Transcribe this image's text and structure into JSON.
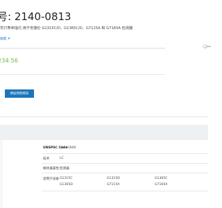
{
  "product": {
    "title_prefix": "号:",
    "part_number": "2140-0813",
    "description": "氘灯寿命指灯,用于安捷伦 G1315C/D、G1365C/D、G7115A 和 G7165A 检测器",
    "collapse_label": "收起",
    "price": "234.56",
    "add_to_cart_label": "添加到购物车"
  },
  "specs": {
    "rows": [
      {
        "label": "UNSPSC Code",
        "value": "39101600"
      },
      {
        "label": "技术",
        "value": "LC"
      },
      {
        "label": "媒体兼容性",
        "value": "检测器"
      },
      {
        "label": "适用于设备",
        "value": ""
      }
    ],
    "compatible_devices": [
      "G1315C",
      "G1315D",
      "G1365C",
      "G1365D",
      "G7115A",
      "G7165A"
    ]
  },
  "colors": {
    "accent": "#1b75bc",
    "price": "#6db33f",
    "band": "#eef1f4"
  }
}
